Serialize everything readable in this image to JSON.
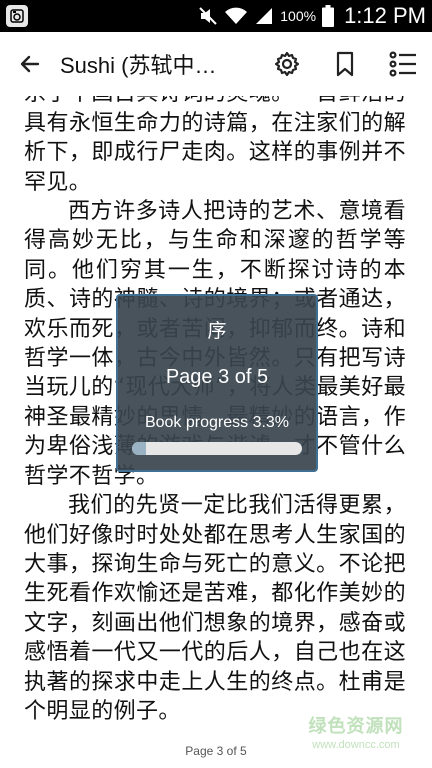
{
  "status_bar": {
    "battery_text": "100%",
    "time": "1:12 PM",
    "icons": [
      "app-notification-icon",
      "mute-icon",
      "wifi-icon",
      "signal-icon",
      "battery-icon"
    ]
  },
  "toolbar": {
    "title": "Sushi (苏轼中…",
    "icons": [
      "back-arrow-icon",
      "settings-gear-icon",
      "bookmark-icon",
      "table-of-contents-icon"
    ]
  },
  "content": {
    "paragraphs": [
      {
        "indent": false,
        "text": "轻视了对诗意和哲学的探究，就等于扼杀了中国古典诗词的灵魂。一首鲜活的具有永恒生命力的诗篇，在注家们的解析下，即成行尸走肉。这样的事例并不罕见。"
      },
      {
        "indent": true,
        "text": "西方许多诗人把诗的艺术、意境看得高妙无比，与生命和深邃的哲学等同。他们穷其一生，不断探讨诗的本质、诗的神髓、诗的境界；或者通达，欢乐而死，或者苦闷，抑郁而终。诗和哲学一体，古今中外皆然。只有把写诗当玩儿的“现代大师”，将人类最美好最神圣最精妙的思情、最精妙的语言，作为卑俗浅薄的游戏与谐谑，才不管什么哲学不哲学。"
      },
      {
        "indent": true,
        "text": "我们的先贤一定比我们活得更累，他们好像时时处处都在思考人生家国的大事，探询生命与死亡的意义。不论把生死看作欢愉还是苦难，都化作美妙的文字，刻画出他们想象的境界，感奋或感悟着一代又一代的后人，自己也在这执著的探求中走上人生的终点。杜甫是个明显的例子。"
      }
    ]
  },
  "popup": {
    "chapter": "序",
    "page_label": "Page 3 of 5",
    "progress_label": "Book progress 3.3%",
    "progress_fraction": 0.033
  },
  "footer": {
    "page_label": "Page 3 of 5"
  },
  "watermark": {
    "main": "绿色资源网",
    "url": "www.downcc.com"
  },
  "colors": {
    "popup_bg": "#3a444e",
    "popup_border": "#3f6f93",
    "progress_track": "#e7e7e7",
    "progress_fill": "#9ab3c4"
  }
}
